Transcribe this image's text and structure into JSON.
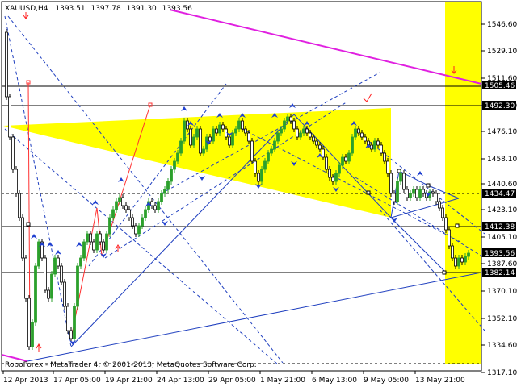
{
  "title": {
    "symbol": "XAUUSD,H4",
    "open": "1393.51",
    "high": "1397.78",
    "low": "1391.30",
    "close": "1393.56"
  },
  "footer_text": "RoboForex - MetaTrader 4, © 2001-2013, MetaQuotes Software Corp.",
  "price_axis": [
    "1546.60",
    "1529.10",
    "1511.60",
    "1493.10",
    "1476.10",
    "1458.10",
    "1440.60",
    "1423.10",
    "1405.10",
    "1387.60",
    "1370.10",
    "1352.10",
    "1334.60",
    "1317.10"
  ],
  "time_axis": [
    "12 Apr 2013",
    "17 Apr 05:00",
    "19 Apr 21:00",
    "24 Apr 13:00",
    "29 Apr 05:00",
    "1 May 21:00",
    "6 May 13:00",
    "9 May 05:00",
    "13 May 21:00"
  ],
  "level_tags": [
    {
      "label": "1505.46",
      "color": "#000000"
    },
    {
      "label": "1492.30",
      "color": "#000000"
    },
    {
      "label": "1434.47",
      "color": "#000000"
    },
    {
      "label": "1412.38",
      "color": "#000000"
    },
    {
      "label": "1393.56",
      "color": "#000000"
    },
    {
      "label": "1382.14",
      "color": "#000000"
    }
  ],
  "colors": {
    "bull": "#2ca02c",
    "bear": "#000000",
    "triangle": "#ffff00",
    "highlight": "#ffff00",
    "trend_magenta": "#e020e0",
    "trend_blue": "#1f3fbf",
    "arrow": "#ff0000"
  },
  "chart_data": {
    "type": "candlestick",
    "symbol": "XAUUSD",
    "timeframe": "H4",
    "last": {
      "open": 1393.51,
      "high": 1397.78,
      "low": 1391.3,
      "close": 1393.56
    },
    "levels": [
      1505.46,
      1492.3,
      1434.47,
      1412.38,
      1393.56,
      1382.14
    ],
    "ylim": [
      1310,
      1560
    ]
  }
}
